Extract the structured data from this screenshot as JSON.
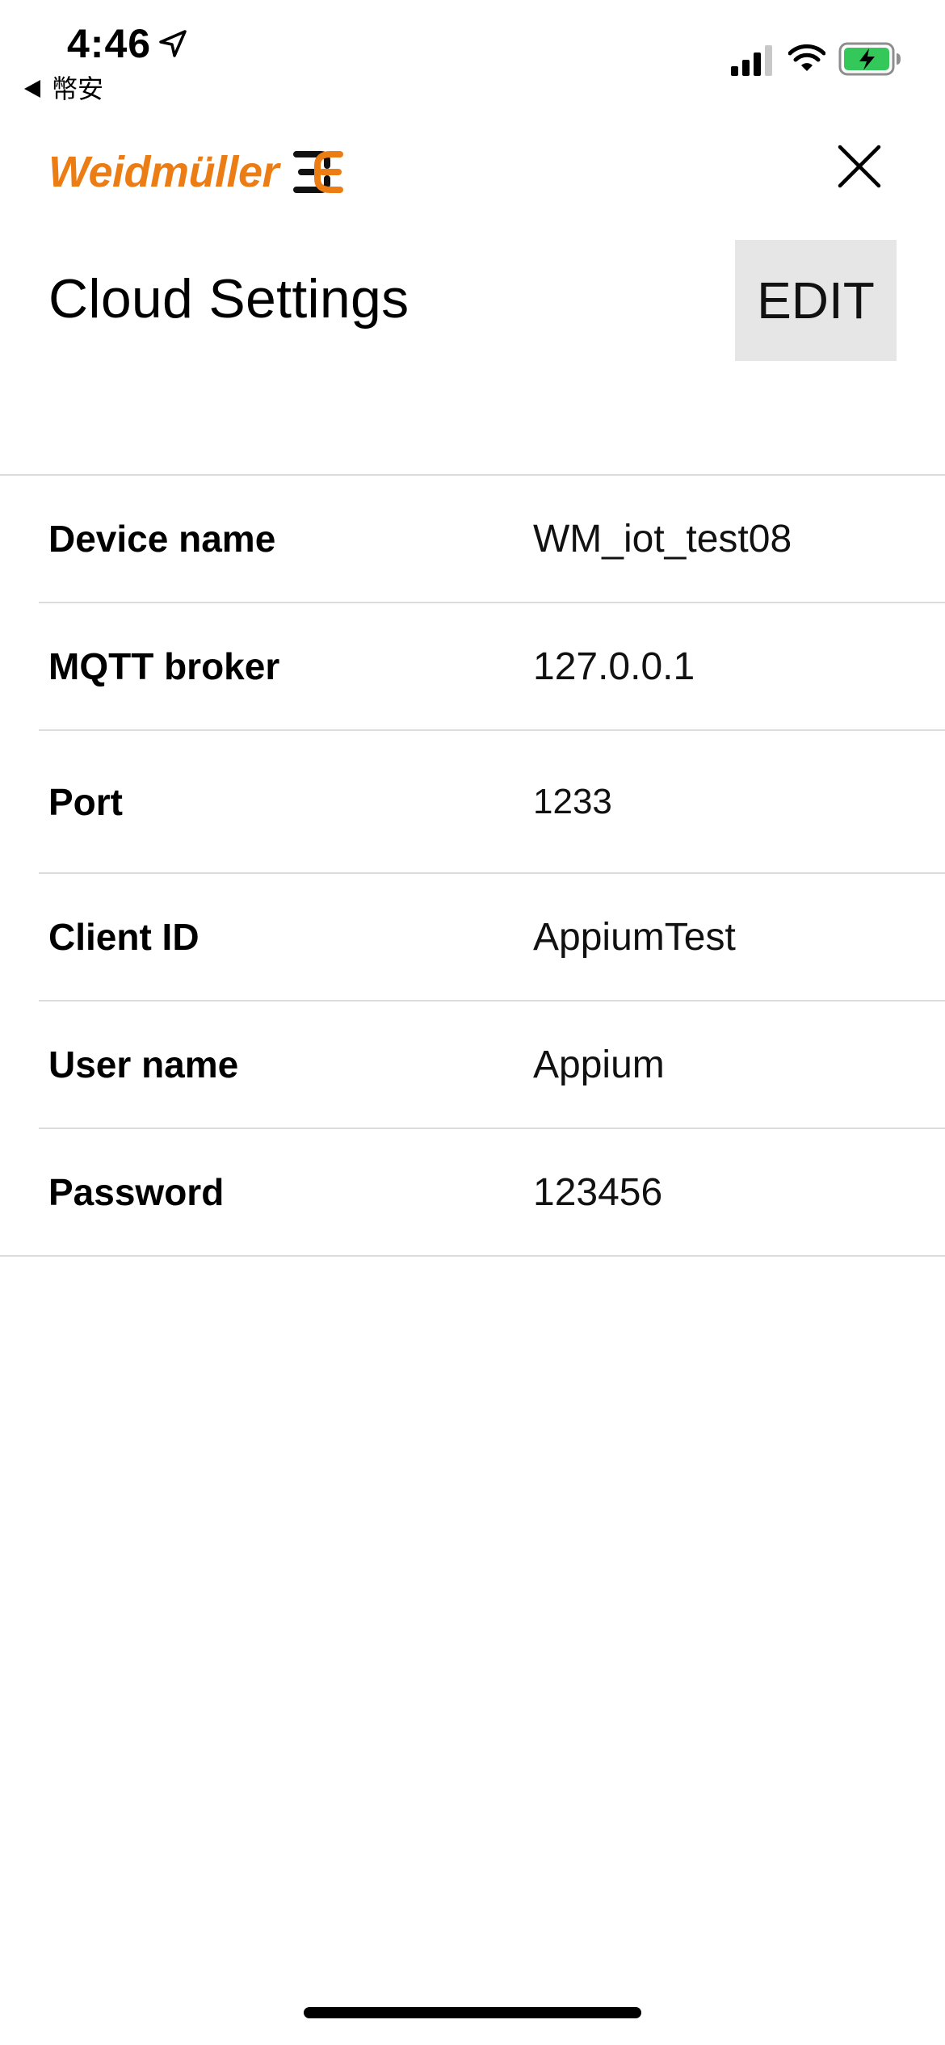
{
  "status_bar": {
    "time": "4:46",
    "back_label": "幣安",
    "battery_color": "#34c759"
  },
  "header": {
    "brand": "Weidmüller",
    "brand_color": "#ec7d15",
    "close_icon": "close-icon"
  },
  "page": {
    "title": "Cloud Settings",
    "edit_label": "EDIT"
  },
  "settings": {
    "rows": [
      {
        "label": "Device name",
        "value": "WM_iot_test08"
      },
      {
        "label": "MQTT broker",
        "value": "127.0.0.1"
      },
      {
        "label": "Port",
        "value": "1233"
      },
      {
        "label": "Client ID",
        "value": "AppiumTest"
      },
      {
        "label": "User name",
        "value": "Appium"
      },
      {
        "label": "Password",
        "value": "123456"
      }
    ]
  }
}
